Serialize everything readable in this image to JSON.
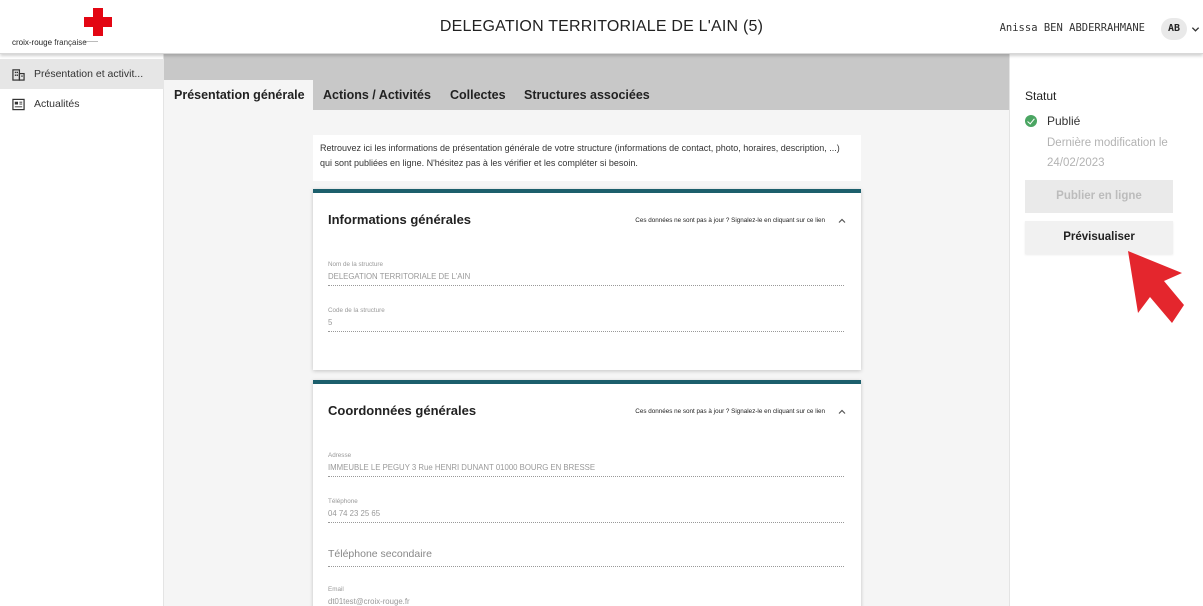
{
  "header": {
    "logo_text_bold": "croix-rouge",
    "logo_text": " française",
    "title": "DELEGATION TERRITORIALE DE L'AIN (5)",
    "user_name": "Anissa BEN ABDERRAHMANE",
    "avatar_initials": "AB"
  },
  "sidebar": {
    "items": [
      {
        "label": "Présentation et activit...",
        "icon": "building-icon"
      },
      {
        "label": "Actualités",
        "icon": "newspaper-icon"
      }
    ]
  },
  "tabs": [
    {
      "label": "Présentation générale"
    },
    {
      "label": "Actions / Activités"
    },
    {
      "label": "Collectes"
    },
    {
      "label": "Structures associées"
    }
  ],
  "intro": "Retrouvez ici les informations de présentation générale de votre structure (informations de contact, photo, horaires, description, ...) qui sont publiées en ligne. N'hésitez pas à les vérifier et les compléter si besoin.",
  "cards": {
    "general": {
      "title": "Informations générales",
      "report_link": "Ces données ne sont pas à jour ? Signalez-le en cliquant sur ce lien",
      "fields": [
        {
          "label": "Nom de la structure",
          "value": "DELEGATION TERRITORIALE DE L'AIN"
        },
        {
          "label": "Code de la structure",
          "value": "5"
        }
      ]
    },
    "contact": {
      "title": "Coordonnées générales",
      "report_link": "Ces données ne sont pas à jour ? Signalez-le en cliquant sur ce lien",
      "fields": [
        {
          "label": "Adresse",
          "value": "IMMEUBLE  LE PEGUY  3 Rue HENRI DUNANT 01000 BOURG EN BRESSE"
        },
        {
          "label": "Téléphone",
          "value": "04 74 23 25 65"
        },
        {
          "placeholder": "Téléphone secondaire"
        },
        {
          "label": "Email",
          "value": "dt01test@croix-rouge.fr"
        }
      ]
    }
  },
  "status_panel": {
    "title": "Statut",
    "status": "Publié",
    "status_color": "#4aa562",
    "last_modified": "Dernière modification le 24/02/2023",
    "publish_button": "Publier en ligne",
    "preview_button": "Prévisualiser"
  },
  "colors": {
    "brand_red": "#e30613",
    "card_accent": "#1c5f6c",
    "pointer_arrow": "#e4262d"
  }
}
